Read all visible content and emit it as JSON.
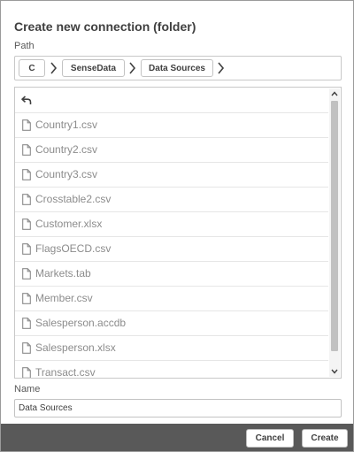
{
  "dialog": {
    "title": "Create new connection (folder)",
    "path_label": "Path",
    "name_label": "Name"
  },
  "breadcrumb": [
    {
      "label": "C"
    },
    {
      "label": "SenseData"
    },
    {
      "label": "Data Sources"
    }
  ],
  "file_list": {
    "back_icon": "back-arrow-icon",
    "items": [
      {
        "name": "Country1.csv",
        "icon": "file-icon"
      },
      {
        "name": "Country2.csv",
        "icon": "file-icon"
      },
      {
        "name": "Country3.csv",
        "icon": "file-icon"
      },
      {
        "name": "Crosstable2.csv",
        "icon": "file-icon"
      },
      {
        "name": "Customer.xlsx",
        "icon": "file-icon"
      },
      {
        "name": "FlagsOECD.csv",
        "icon": "file-icon"
      },
      {
        "name": "Markets.tab",
        "icon": "file-icon"
      },
      {
        "name": "Member.csv",
        "icon": "file-icon"
      },
      {
        "name": "Salesperson.accdb",
        "icon": "file-icon"
      },
      {
        "name": "Salesperson.xlsx",
        "icon": "file-icon"
      },
      {
        "name": "Transact.csv",
        "icon": "file-icon"
      }
    ]
  },
  "name_field": {
    "value": "Data Sources"
  },
  "footer": {
    "cancel_label": "Cancel",
    "create_label": "Create"
  }
}
